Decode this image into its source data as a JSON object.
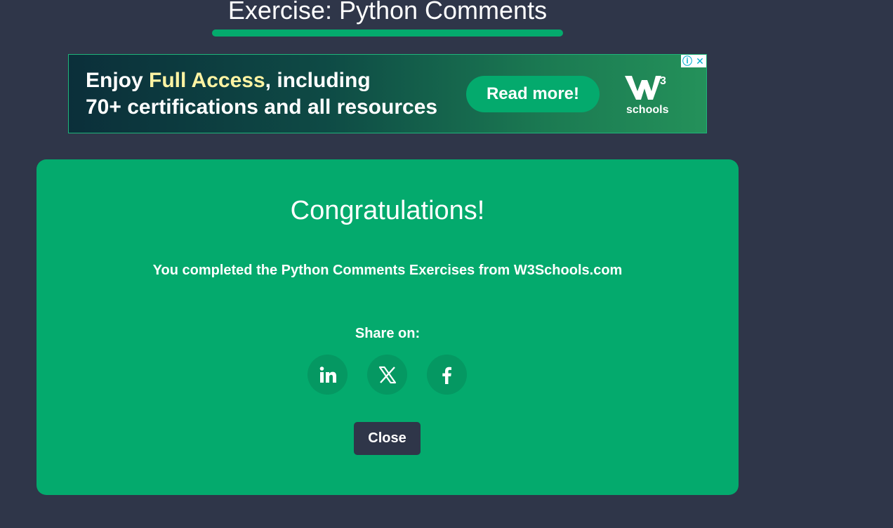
{
  "header": {
    "title": "Exercise: Python Comments"
  },
  "ad": {
    "line1_prefix": "Enjoy ",
    "line1_highlight": "Full Access",
    "line1_suffix": ", including",
    "line2": "70+ certifications and all resources",
    "button_label": "Read more!",
    "logo_superscript": "3",
    "logo_text": "schools",
    "choices_icons": [
      "info-icon",
      "close-icon"
    ],
    "info_glyph": "ⓘ",
    "close_glyph": "✕"
  },
  "modal": {
    "title": "Congratulations!",
    "message": "You completed the Python Comments Exercises from W3Schools.com",
    "share_label": "Share on:",
    "share_targets": [
      "linkedin-icon",
      "x-icon",
      "facebook-icon"
    ],
    "close_label": "Close"
  },
  "colors": {
    "background": "#2f3649",
    "accent": "#04aa6d",
    "highlight": "#fff4a3"
  }
}
